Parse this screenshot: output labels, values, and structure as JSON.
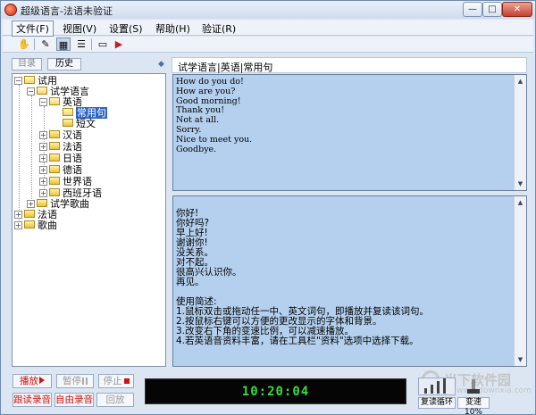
{
  "window": {
    "title": "超级语言-法语未验证",
    "buttons": {
      "minimize": "—",
      "maximize": "□",
      "close": "✕"
    }
  },
  "menu": [
    {
      "label": "文件(F)"
    },
    {
      "label": "视图(V)"
    },
    {
      "label": "设置(S)"
    },
    {
      "label": "帮助(H)"
    },
    {
      "label": "验证(R)"
    }
  ],
  "toolbar": {
    "icons": [
      "hand-icon",
      "edit-icon",
      "select-icon",
      "list-icon",
      "monitor-icon",
      "play-icon"
    ]
  },
  "left_tabs": {
    "catalog": "目录",
    "history": "历史"
  },
  "tree": {
    "root": "试用",
    "l1": "试学语言",
    "l2": "英语",
    "selected": "常用句",
    "short": "短文",
    "languages": [
      "汉语",
      "法语",
      "日语",
      "德语",
      "世界语",
      "西班牙语"
    ],
    "songs_trial": "试学歌曲",
    "fr": "法语",
    "songs": "歌曲"
  },
  "path": "试学语言|英语|常用句",
  "english_text": "How do you do!\nHow are you?\nGood morning!\nThank you!\nNot at all.\nSorry.\nNice to meet you.\nGoodbye.",
  "chinese_text": "你好!\n你好吗?\n早上好!\n谢谢你!\n没关系。\n对不起。\n很高兴认识你。\n再见。\n\n使用简述:\n1.鼠标双击或拖动任一中、英文词句，即播放并复读该词句。\n2.按鼠标右键可以方便的更改显示的字体和背景。\n3.改变右下角的变速比例，可以减速播放。\n4.若英语音资料丰富，请在工具栏\"资料\"选项中选择下载。",
  "controls": {
    "play": "播放",
    "pause": "暂停",
    "stop": "停止",
    "follow_record": "跟读录音",
    "free_record": "自由录音",
    "playback": "回放"
  },
  "clock": "10:20:04",
  "repeat_label": "复读循环",
  "speed_label": "变速10%",
  "watermark": {
    "text": "当下软件园",
    "sub": "www.downxia.com"
  },
  "colors": {
    "pane_bg": "#b4d0ee",
    "clock_fg": "#3bdc3b",
    "accent_red": "#d4100a"
  }
}
